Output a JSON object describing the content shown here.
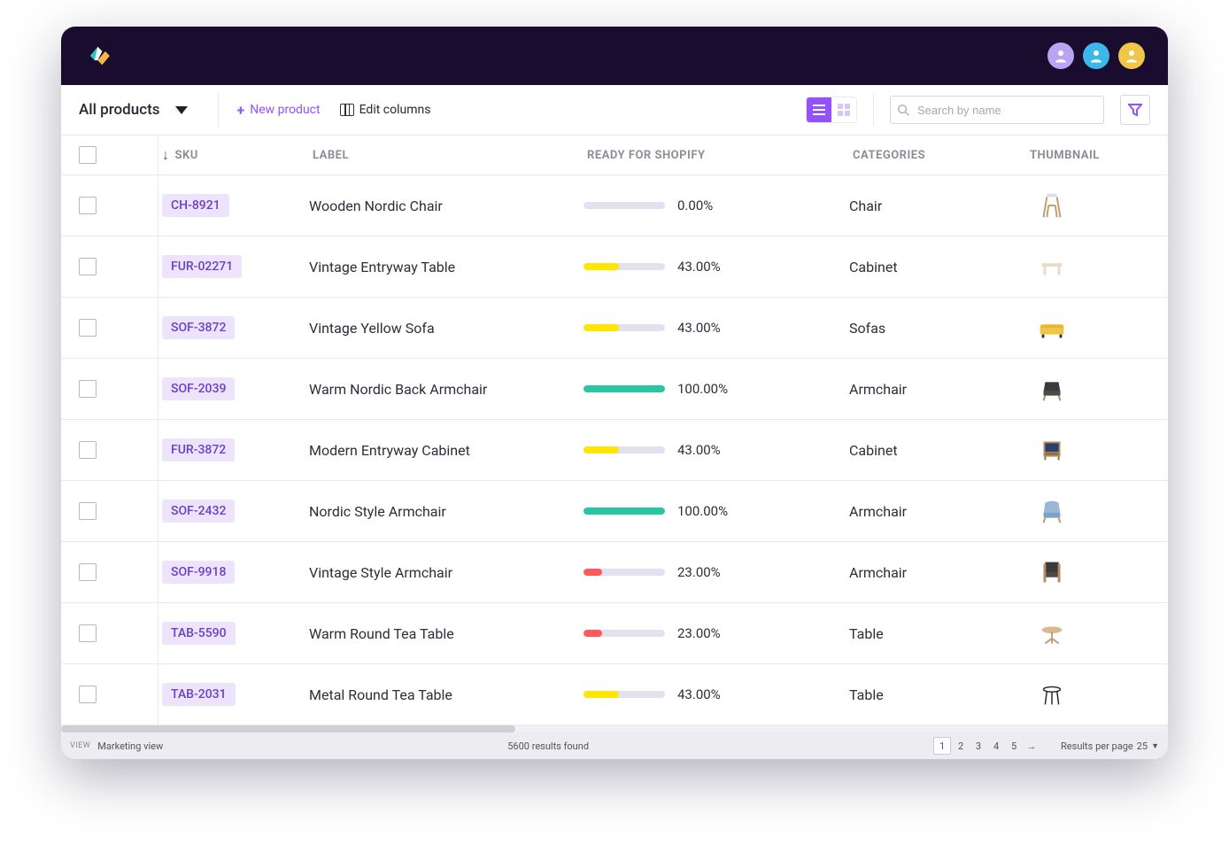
{
  "header": {
    "avatars": [
      {
        "color": "#b9a4f2"
      },
      {
        "color": "#3bb7ea"
      },
      {
        "color": "#f0c64a"
      }
    ]
  },
  "toolbar": {
    "filter_label": "All products",
    "new_product": "New product",
    "edit_columns": "Edit columns",
    "search_placeholder": "Search by name"
  },
  "columns": {
    "sku": "SKU",
    "label": "LABEL",
    "ready": "READY FOR SHOPIFY",
    "categories": "CATEGORIES",
    "thumbnail": "THUMBNAIL"
  },
  "rows": [
    {
      "sku": "CH-8921",
      "label": "Wooden Nordic Chair",
      "pct": 0.0,
      "pct_text": "0.00%",
      "category": "Chair",
      "thumb": "chair-wood"
    },
    {
      "sku": "FUR-02271",
      "label": "Vintage Entryway Table",
      "pct": 43.0,
      "pct_text": "43.00%",
      "category": "Cabinet",
      "thumb": "table-beige"
    },
    {
      "sku": "SOF-3872",
      "label": "Vintage Yellow Sofa",
      "pct": 43.0,
      "pct_text": "43.00%",
      "category": "Sofas",
      "thumb": "sofa-yellow"
    },
    {
      "sku": "SOF-2039",
      "label": "Warm Nordic Back Armchair",
      "pct": 100.0,
      "pct_text": "100.00%",
      "category": "Armchair",
      "thumb": "armchair-dark"
    },
    {
      "sku": "FUR-3872",
      "label": "Modern Entryway Cabinet",
      "pct": 43.0,
      "pct_text": "43.00%",
      "category": "Cabinet",
      "thumb": "cabinet"
    },
    {
      "sku": "SOF-2432",
      "label": "Nordic Style Armchair",
      "pct": 100.0,
      "pct_text": "100.00%",
      "category": "Armchair",
      "thumb": "armchair-blue"
    },
    {
      "sku": "SOF-9918",
      "label": "Vintage Style Armchair",
      "pct": 23.0,
      "pct_text": "23.00%",
      "category": "Armchair",
      "thumb": "armchair-wood"
    },
    {
      "sku": "TAB-5590",
      "label": "Warm Round Tea Table",
      "pct": 23.0,
      "pct_text": "23.00%",
      "category": "Table",
      "thumb": "table-round"
    },
    {
      "sku": "TAB-2031",
      "label": "Metal Round Tea Table",
      "pct": 43.0,
      "pct_text": "43.00%",
      "category": "Table",
      "thumb": "table-metal"
    }
  ],
  "footer": {
    "view_label": "VIEW",
    "view_name": "Marketing view",
    "results": "5600 results found",
    "pages": [
      "1",
      "2",
      "3",
      "4",
      "5"
    ],
    "active_page": "1",
    "rpp_label": "Results per page",
    "rpp_value": "25"
  }
}
